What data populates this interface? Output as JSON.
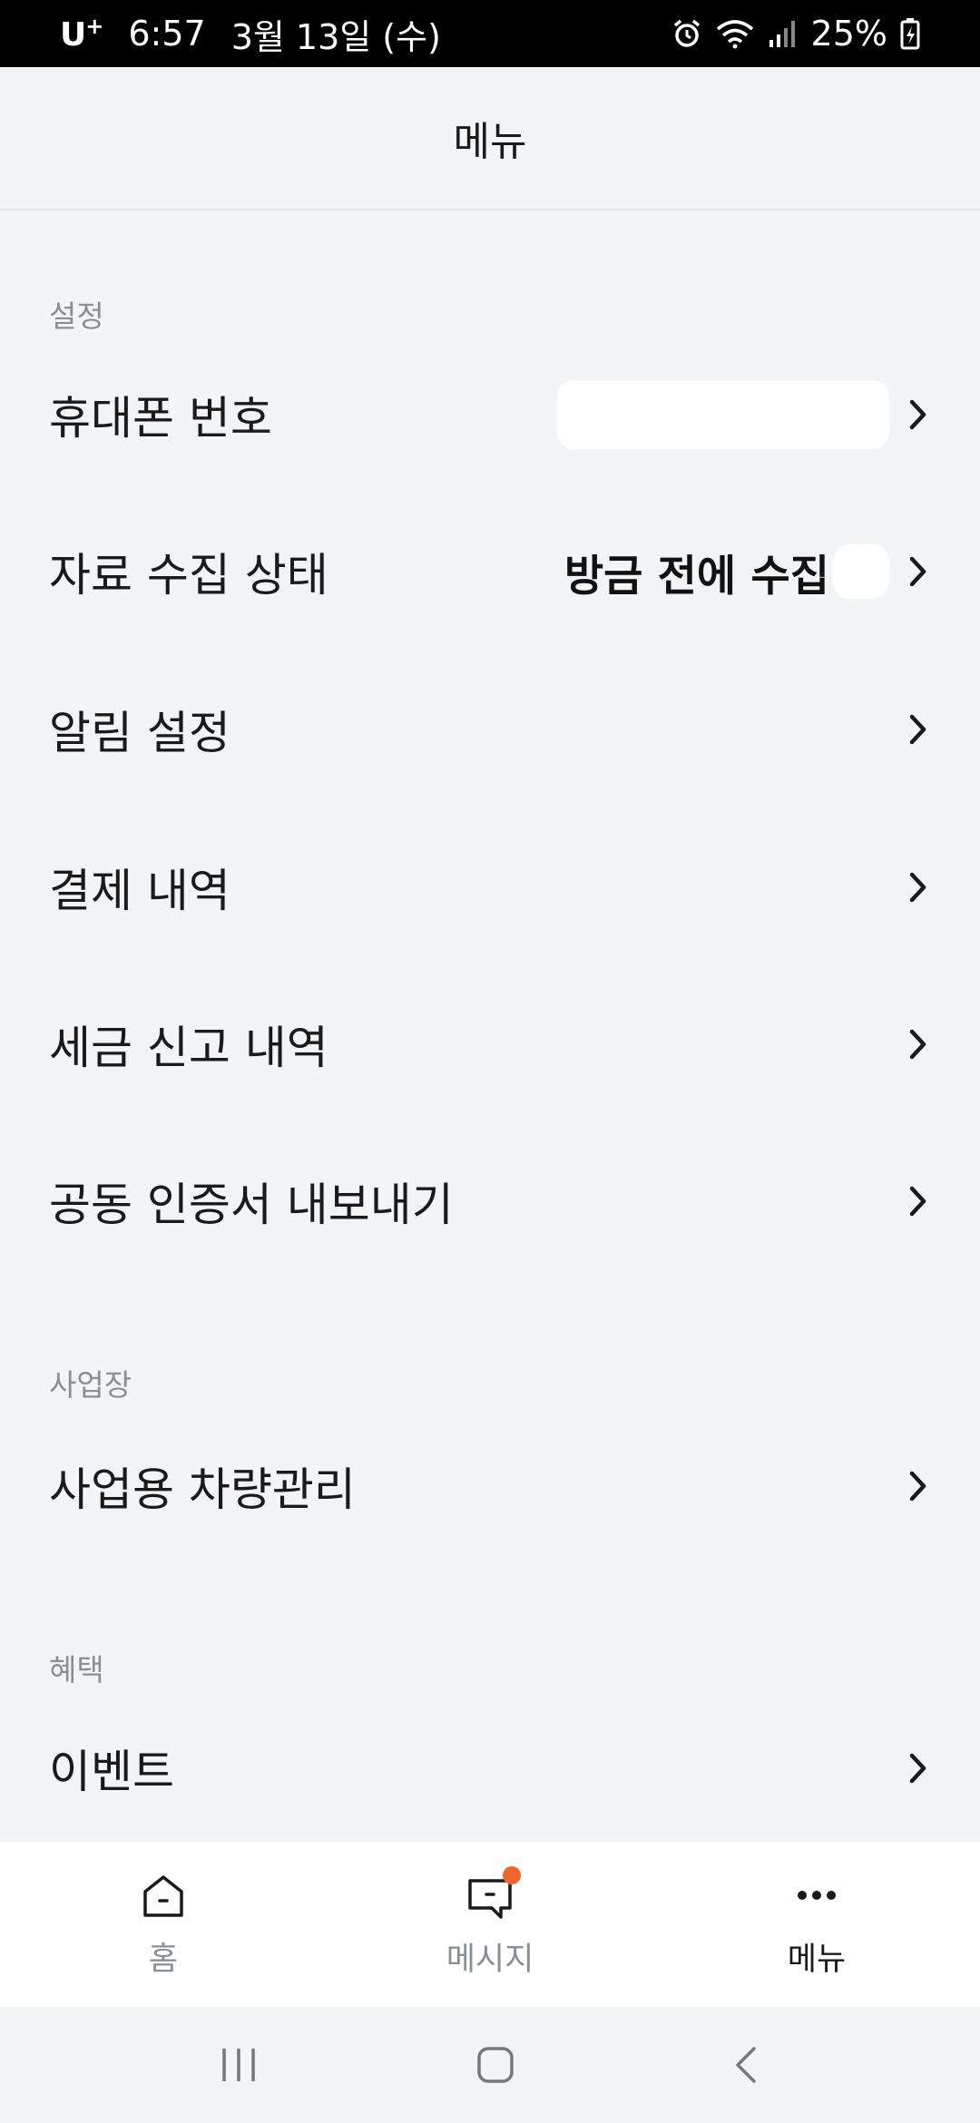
{
  "status_bar": {
    "carrier": "U",
    "carrier_plus": "+",
    "time": "6:57",
    "date": "3월 13일 (수)",
    "battery": "25%"
  },
  "header": {
    "title": "메뉴"
  },
  "sections": {
    "settings": {
      "label": "설정",
      "items": [
        {
          "label": "휴대폰 번호",
          "value": ""
        },
        {
          "label": "자료 수집 상태",
          "value": "방금 전에 수집"
        },
        {
          "label": "알림 설정"
        },
        {
          "label": "결제 내역"
        },
        {
          "label": "세금 신고 내역"
        },
        {
          "label": "공동 인증서 내보내기"
        }
      ]
    },
    "business": {
      "label": "사업장",
      "items": [
        {
          "label": "사업용 차량관리"
        }
      ]
    },
    "benefits": {
      "label": "혜택",
      "items": [
        {
          "label": "이벤트"
        }
      ]
    }
  },
  "bottom_nav": {
    "items": [
      {
        "label": "홈",
        "icon": "home-icon"
      },
      {
        "label": "메시지",
        "icon": "message-icon",
        "has_badge": true
      },
      {
        "label": "메뉴",
        "icon": "more-dots-icon",
        "active": true
      }
    ]
  },
  "colors": {
    "background": "#f3f4f6",
    "badge": "#f0642d",
    "muted_text": "#8a8d93"
  }
}
